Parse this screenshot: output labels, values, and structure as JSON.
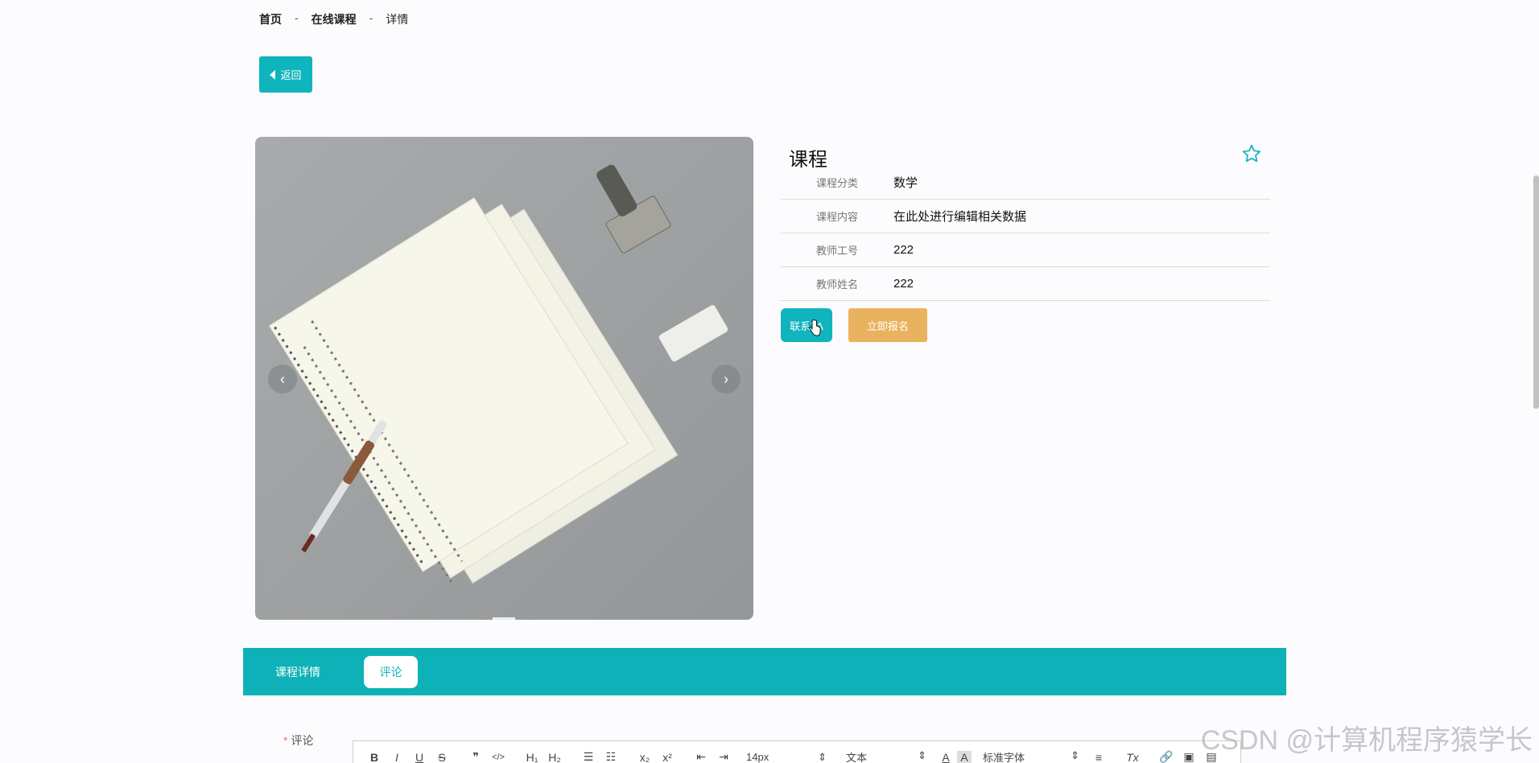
{
  "breadcrumb": {
    "home": "首页",
    "section": "在线课程",
    "current": "详情",
    "separator": "-"
  },
  "back_button": {
    "label": "返回"
  },
  "gallery": {
    "prev": "‹",
    "next": "›"
  },
  "course": {
    "title": "课程",
    "fields": [
      {
        "label": "课程分类",
        "value": "数学"
      },
      {
        "label": "课程内容",
        "value": "在此处进行编辑相关数据"
      },
      {
        "label": "教师工号",
        "value": "222"
      },
      {
        "label": "教师姓名",
        "value": "222"
      }
    ],
    "contact_button": "联系TA",
    "enroll_button": "立即报名"
  },
  "tabs": [
    {
      "label": "课程详情",
      "active": false
    },
    {
      "label": "评论",
      "active": true
    }
  ],
  "comment": {
    "required_mark": "*",
    "label": "评论"
  },
  "toolbar": {
    "bold": "B",
    "italic": "I",
    "underline": "U",
    "strike": "S",
    "quote": "❞",
    "code": "</>",
    "h1": "H₁",
    "h2": "H₂",
    "ol": "☰",
    "ul": "☷",
    "sub": "x₂",
    "sup": "x²",
    "outdent": "⇤",
    "indent": "⇥",
    "size": "14px",
    "format": "文本",
    "font": "标准字体",
    "align": "≡",
    "clear": "Tx",
    "link": "🔗",
    "image": "▣",
    "video": "▤"
  },
  "colors": {
    "accent": "#10b4bd",
    "enroll": "#e9b25e"
  },
  "watermark": "CSDN @计算机程序猿学长"
}
